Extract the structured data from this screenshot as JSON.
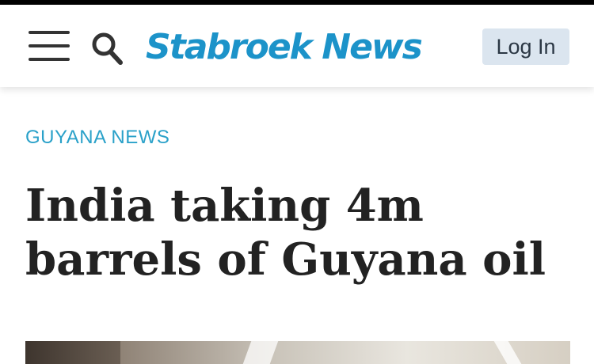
{
  "header": {
    "logo_text": "Stabroek News",
    "login_label": "Log In",
    "menu_icon": "hamburger-menu-icon",
    "search_icon": "search-icon",
    "brand_color": "#1c93c9"
  },
  "article": {
    "section": "GUYANA NEWS",
    "headline": "India taking 4m barrels of Guyana oil",
    "section_color": "#2aa1c9"
  }
}
